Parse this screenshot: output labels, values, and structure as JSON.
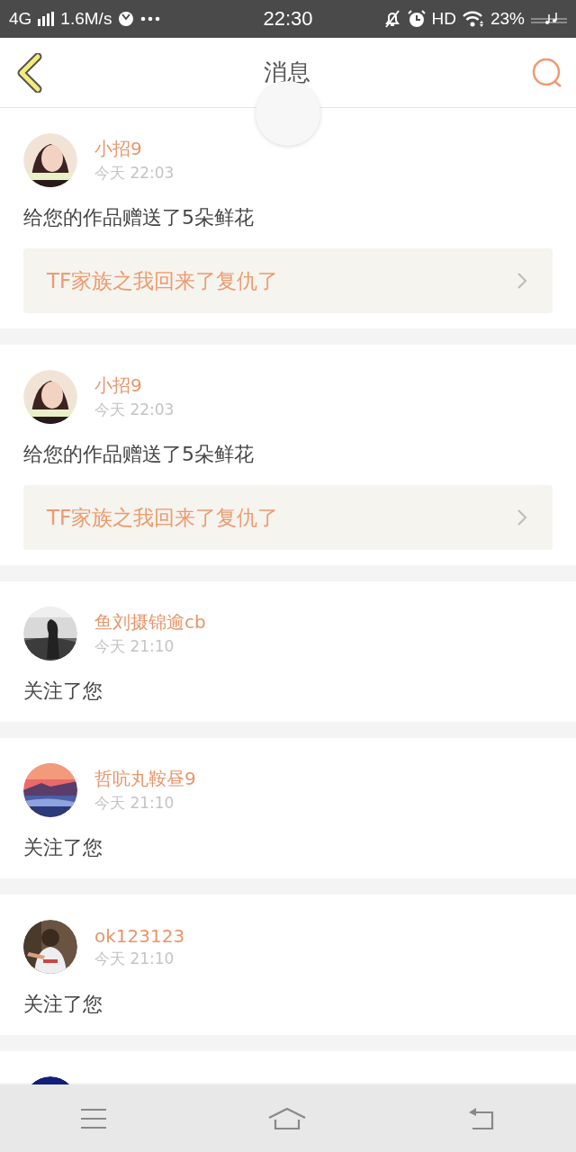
{
  "status_bar": {
    "network": "4G",
    "speed": "1.6M/s",
    "time": "22:30",
    "hd": "HD",
    "battery": "23%"
  },
  "header": {
    "title": "消息"
  },
  "messages": [
    {
      "kind": "gift",
      "user": "小招9",
      "time": "今天 22:03",
      "text": "给您的作品赠送了5朵鲜花",
      "link": "TF家族之我回来了复仇了"
    },
    {
      "kind": "gift",
      "user": "小招9",
      "time": "今天 22:03",
      "text": "给您的作品赠送了5朵鲜花",
      "link": "TF家族之我回来了复仇了"
    },
    {
      "kind": "follow",
      "user": "鱼刘摄锦逾cb",
      "time": "今天 21:10",
      "text": "关注了您"
    },
    {
      "kind": "follow",
      "user": "哲吭丸鞍昼9",
      "time": "今天 21:10",
      "text": "关注了您"
    },
    {
      "kind": "follow",
      "user": "ok123123",
      "time": "今天 21:10",
      "text": "关注了您"
    },
    {
      "kind": "cut"
    }
  ]
}
